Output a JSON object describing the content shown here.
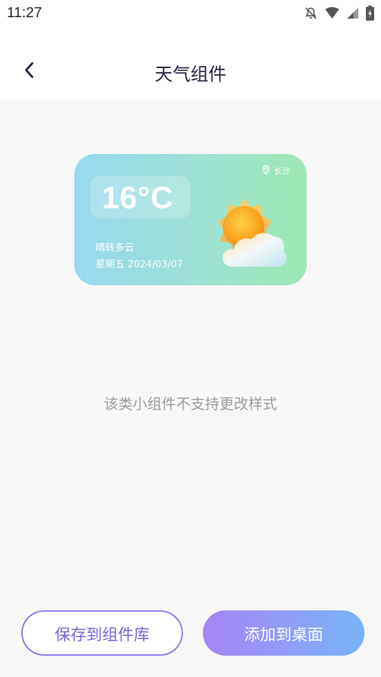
{
  "status_bar": {
    "time": "11:27",
    "icons": [
      "notifications-off-icon",
      "wifi-icon",
      "cell-signal-icon",
      "battery-charging-icon"
    ]
  },
  "header": {
    "title": "天气组件",
    "back_icon": "chevron-left-icon"
  },
  "widget": {
    "location": "长沙",
    "location_icon": "location-pin-icon",
    "temperature": "16°C",
    "condition": "晴转多云",
    "date": "星期五 2024/03/07",
    "weather_icon": "sun-cloud-icon",
    "colors": {
      "gradient_start": "#98d9ef",
      "gradient_end": "#9ee8b3"
    }
  },
  "notice": "该类小组件不支持更改样式",
  "buttons": {
    "save_label": "保存到组件库",
    "add_label": "添加到桌面"
  },
  "colors": {
    "accent": "#8a73e8",
    "title": "#1f1f3f",
    "muted_text": "#9a9a9a"
  }
}
